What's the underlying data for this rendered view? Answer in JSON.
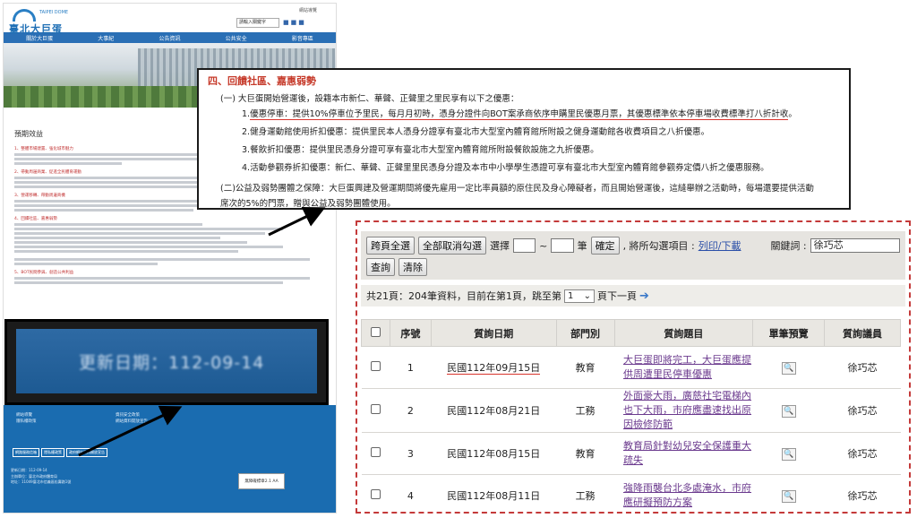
{
  "site": {
    "logo_text": "臺北大巨蛋",
    "logo_sub": "TAIPEI DOME",
    "top_links": "網站導覽",
    "search_placeholder": "請輸入關鍵字",
    "nav": [
      "關於大巨蛋",
      "大事紀",
      "公告資訊",
      "公共安全",
      "影音專區"
    ],
    "page_title": "預期效益",
    "sections": [
      "1、整體市場建置、強化城市魅力",
      "2、帶動周邊商業、促進全民體育運動",
      "3、營運移轉、帶動周邊商機",
      "4、回饋社區、嘉惠弱勢",
      "5、BOT民間參與、創造公共利益"
    ],
    "footer_links_left": [
      "網站導覽",
      "隱私權政策"
    ],
    "footer_links_right": [
      "資訊安全政策",
      "網站資料開放宣告"
    ],
    "footer_buttons": [
      "網路服務信箱",
      "隱私權政策",
      "政府網站資料開放宣告"
    ],
    "footer_info": [
      "更新日期：112-09-14",
      "主辦單位：臺北市政府體育局",
      "地址：11049臺北市信義區松壽路1號"
    ],
    "accessibility_badge": "無障礙標章2.1 AA"
  },
  "update_box": {
    "text": "更新日期：112-09-14"
  },
  "section4": {
    "title": "四、回饋社區、嘉惠弱勢",
    "intro": "(一) 大巨蛋開始營運後，設籍本市新仁、華聲、正聲里之里民享有以下之優惠：",
    "items": [
      {
        "prefix": "1.",
        "underlined": "優惠停車：提供10%停車位予里民，每月月初時，憑身分證件向BOT案承商依序申購里民優惠月票，其優惠標準依本停車場收費標準打八折計收",
        "suffix": "。"
      },
      {
        "prefix": "2.",
        "underlined": "",
        "suffix": "健身運動館使用折扣優惠：提供里民本人憑身分證享有臺北市大型室內體育館所附設之健身運動館各收費項目之八折優惠。"
      },
      {
        "prefix": "3.",
        "underlined": "",
        "suffix": "餐飲折扣優惠：提供里民憑身分證可享有臺北市大型室內體育館所附設餐飲設施之九折優惠。"
      },
      {
        "prefix": "4.",
        "underlined": "",
        "suffix": "活動參觀券折扣優惠：新仁、華聲、正聲里里民憑身分證及本市中小學學生憑證可享有臺北市大型室內體育館參觀券定價八折之優惠服務。"
      }
    ],
    "guarantee_line1": "(二)公益及弱勢團體之保障：大巨蛋興建及營運期間將優先雇用一定比率員額的原住民及身心障礙者，而且開始營運後，這縫舉辦之活動時，每場還要提供活動",
    "guarantee_line2": "席次的5%的門票，贈與公益及弱勢團體使用。"
  },
  "results": {
    "btn_select_all": "跨頁全選",
    "btn_clear_all": "全部取消勾選",
    "select_label": "選擇",
    "tilde": "~",
    "unit": "筆",
    "btn_confirm": "確定",
    "action_label": ", 將所勾選項目 :",
    "print_link": "列印/下載",
    "keyword_label": "關鍵詞 :",
    "keyword_value": "徐巧芯",
    "btn_query": "查詢",
    "btn_reset": "清除",
    "pager_text": "共21頁：204筆資料，目前在第1頁，跳至第",
    "page_value": "1",
    "pager_suffix": "頁下一頁",
    "columns": [
      "序號",
      "質詢日期",
      "部門別",
      "質詢題目",
      "單筆預覽",
      "質詢議員"
    ],
    "rows": [
      {
        "no": "1",
        "date": "民國112年09月15日",
        "dept": "教育",
        "topic": "大巨蛋即將完工，大巨蛋應提供周遭里民停車優惠",
        "councilor": "徐巧芯"
      },
      {
        "no": "2",
        "date": "民國112年08月21日",
        "dept": "工務",
        "topic": "外面豪大雨，廣慈社宅電梯內也下大雨，市府應盡速找出原因檢修防範",
        "councilor": "徐巧芯"
      },
      {
        "no": "3",
        "date": "民國112年08月15日",
        "dept": "教育",
        "topic": "教育局針對幼兒安全保護重大疏失",
        "councilor": "徐巧芯"
      },
      {
        "no": "4",
        "date": "民國112年08月11日",
        "dept": "工務",
        "topic": "強降雨襲台北多處淹水，市府應研擬預防方案",
        "councilor": "徐巧芯"
      }
    ]
  }
}
